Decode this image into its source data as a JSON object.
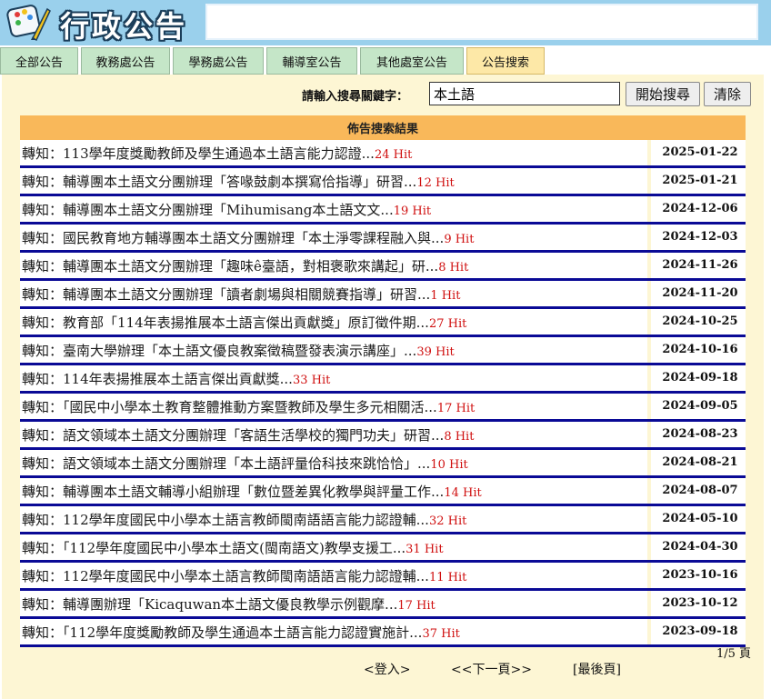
{
  "header": {
    "title": "行政公告"
  },
  "tabs": [
    {
      "label": "全部公告"
    },
    {
      "label": "教務處公告"
    },
    {
      "label": "學務處公告"
    },
    {
      "label": "輔導室公告"
    },
    {
      "label": "其他處室公告"
    },
    {
      "label": "公告搜索",
      "active": true
    }
  ],
  "search": {
    "label": "請輸入搜尋關鍵字：",
    "value": "本土語",
    "start_label": "開始搜尋",
    "clear_label": "清除"
  },
  "results": {
    "heading": "佈告搜索結果",
    "rows": [
      {
        "title": "轉知：113學年度獎勵教師及學生通過本土語言能力認證...",
        "hits": "24 Hit",
        "date": "2025-01-22"
      },
      {
        "title": "轉知：輔導團本土語文分團辦理「答喙鼓劇本撰寫佮指導」研習...",
        "hits": "12 Hit",
        "date": "2025-01-21"
      },
      {
        "title": "轉知：輔導團本土語文分團辦理「Mihumisang本土語文文...",
        "hits": "19 Hit",
        "date": "2024-12-06"
      },
      {
        "title": "轉知：國民教育地方輔導團本土語文分團辦理「本土淨零課程融入與...",
        "hits": "9 Hit",
        "date": "2024-12-03"
      },
      {
        "title": "轉知：輔導團本土語文分團辦理「趣味ê臺語，對相褒歌來講起」研...",
        "hits": "8 Hit",
        "date": "2024-11-26"
      },
      {
        "title": "轉知：輔導團本土語文分團辦理「讀者劇場與相關競賽指導」研習...",
        "hits": "1 Hit",
        "date": "2024-11-20"
      },
      {
        "title": "轉知：教育部「114年表揚推展本土語言傑出貢獻獎」原訂徵件期...",
        "hits": "27 Hit",
        "date": "2024-10-25"
      },
      {
        "title": "轉知：臺南大學辦理「本土語文優良教案徵稿暨發表演示講座」...",
        "hits": "39 Hit",
        "date": "2024-10-16"
      },
      {
        "title": "轉知：114年表揚推展本土語言傑出貢獻獎...",
        "hits": "33 Hit",
        "date": "2024-09-18"
      },
      {
        "title": "轉知：「國民中小學本土教育整體推動方案暨教師及學生多元相關活...",
        "hits": "17 Hit",
        "date": "2024-09-05"
      },
      {
        "title": "轉知：語文領域本土語文分團辦理「客語生活學校的獨門功夫」研習...",
        "hits": "8 Hit",
        "date": "2024-08-23"
      },
      {
        "title": "轉知：語文領域本土語文分團辦理「本土語評量佮科技來跳恰恰」...",
        "hits": "10 Hit",
        "date": "2024-08-21"
      },
      {
        "title": "轉知：輔導團本土語文輔導小組辦理「數位暨差異化教學與評量工作...",
        "hits": "14 Hit",
        "date": "2024-08-07"
      },
      {
        "title": "轉知：112學年度國民中小學本土語言教師閩南語語言能力認證輔...",
        "hits": "32 Hit",
        "date": "2024-05-10"
      },
      {
        "title": "轉知：「112學年度國民中小學本土語文(閩南語文)教學支援工...",
        "hits": "31 Hit",
        "date": "2024-04-30"
      },
      {
        "title": "轉知：112學年度國民中小學本土語言教師閩南語語言能力認證輔...",
        "hits": "11 Hit",
        "date": "2023-10-16"
      },
      {
        "title": "轉知：輔導團辦理「Kicaquwan本土語文優良教學示例觀摩...",
        "hits": "17 Hit",
        "date": "2023-10-12"
      },
      {
        "title": "轉知：「112學年度獎勵教師及學生通過本土語言能力認證實施計...",
        "hits": "37 Hit",
        "date": "2023-09-18"
      }
    ]
  },
  "pagination": {
    "page_info": "1/5 頁",
    "login": "<登入>",
    "next": "<<下一頁>>",
    "last": "[最後頁]"
  },
  "colors": {
    "header_bg": "#9ad0ec",
    "tab_bg": "#c5e6c8",
    "tab_active_bg": "#fde8a7",
    "panel_bg": "#fdf6d4",
    "results_head_bg": "#f9b85a",
    "row_divider": "#0a0a96",
    "hit_color": "#d01010"
  },
  "icons": {
    "logo": "paint-palette-icon"
  }
}
